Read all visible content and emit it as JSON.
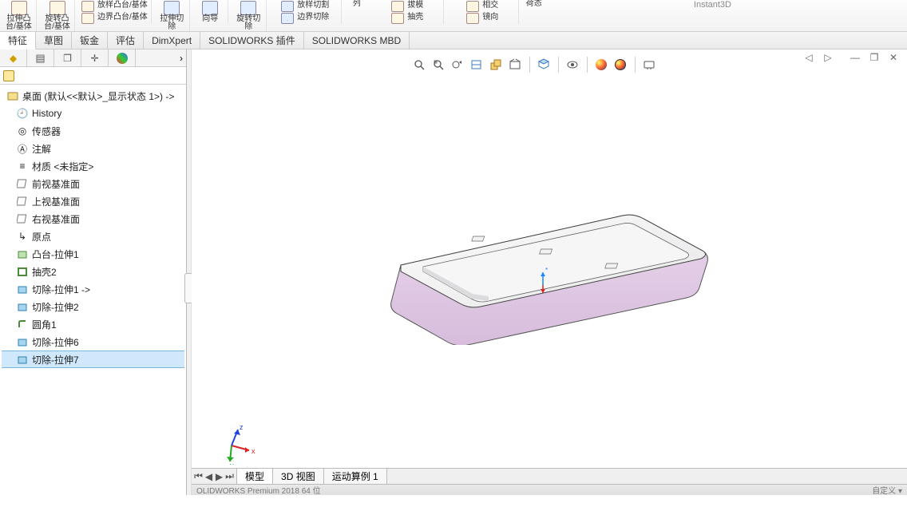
{
  "ribbon": {
    "groups": [
      {
        "label": "拉伸凸\n台/基体"
      },
      {
        "label": "旋转凸\n台/基体"
      },
      {
        "label": "放样凸台/基体"
      },
      {
        "label": "边界凸台/基体"
      },
      {
        "label": "拉伸切\n除"
      },
      {
        "label": "向导"
      },
      {
        "label": "旋转切\n除"
      },
      {
        "label": "放样切割"
      },
      {
        "label": "边界切除"
      },
      {
        "label": "列"
      },
      {
        "label": "拔模"
      },
      {
        "label": "相交"
      },
      {
        "label": "抽壳"
      },
      {
        "label": "镜向"
      },
      {
        "label": "荷态"
      }
    ],
    "rightHint": "Instant3D"
  },
  "featureTabs": [
    "特征",
    "草图",
    "钣金",
    "评估",
    "DimXpert",
    "SOLIDWORKS 插件",
    "SOLIDWORKS MBD"
  ],
  "tree": {
    "root": "桌面  (默认<<默认>_显示状态 1>) ->",
    "nodes": [
      {
        "icon": "history",
        "label": "History"
      },
      {
        "icon": "sensor",
        "label": "传感器"
      },
      {
        "icon": "annot",
        "label": "注解"
      },
      {
        "icon": "material",
        "label": "材质 <未指定>"
      },
      {
        "icon": "plane",
        "label": "前视基准面"
      },
      {
        "icon": "plane",
        "label": "上视基准面"
      },
      {
        "icon": "plane",
        "label": "右视基准面"
      },
      {
        "icon": "origin",
        "label": "原点"
      },
      {
        "icon": "boss",
        "label": "凸台-拉伸1"
      },
      {
        "icon": "shell",
        "label": "抽壳2"
      },
      {
        "icon": "cut",
        "label": "切除-拉伸1  ->"
      },
      {
        "icon": "cut",
        "label": "切除-拉伸2"
      },
      {
        "icon": "fillet",
        "label": "圆角1"
      },
      {
        "icon": "cut",
        "label": "切除-拉伸6"
      },
      {
        "icon": "cut",
        "label": "切除-拉伸7",
        "selected": true
      }
    ]
  },
  "bottomTabs": [
    "模型",
    "3D 视图",
    "运动算例 1"
  ],
  "status": {
    "left": "OLIDWORKS Premium 2018   64 位",
    "right": "自定义  ▾"
  },
  "triadLabels": {
    "x": "x",
    "y": "y",
    "z": "z"
  }
}
